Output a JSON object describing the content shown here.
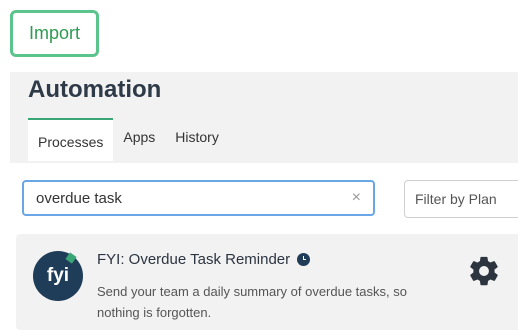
{
  "toolbar": {
    "import_label": "Import"
  },
  "page": {
    "title": "Automation",
    "tabs": [
      {
        "label": "Processes",
        "active": true
      },
      {
        "label": "Apps",
        "active": false
      },
      {
        "label": "History",
        "active": false
      }
    ]
  },
  "search": {
    "value": "overdue task",
    "clear_icon": "×"
  },
  "filter": {
    "placeholder": "Filter by Plan"
  },
  "results": [
    {
      "logo_text": "fyi",
      "title": "FYI: Overdue Task Reminder",
      "description": "Send your team a daily summary of overdue tasks, so nothing is forgotten.",
      "icons": [
        "clock-icon",
        "gear-icon"
      ]
    }
  ],
  "colors": {
    "accent_green": "#3aa675",
    "focus_blue": "#6aa6e6",
    "logo_navy": "#1f3c58"
  }
}
